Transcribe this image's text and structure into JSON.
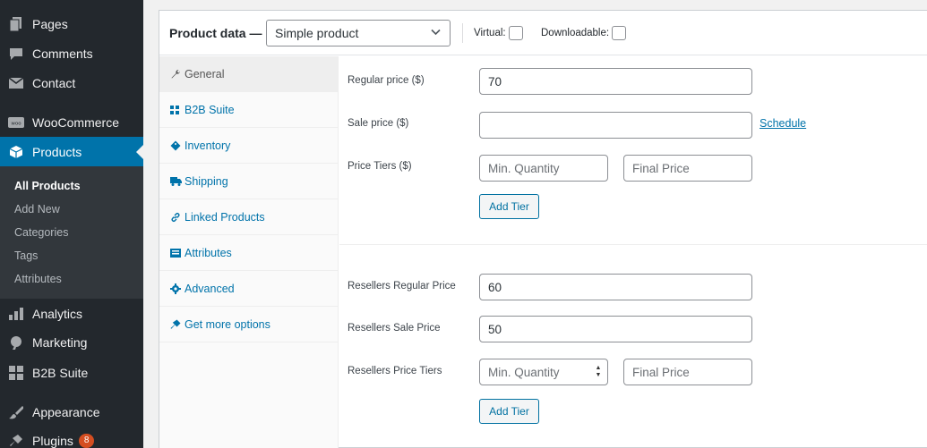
{
  "sidebar": {
    "items": [
      {
        "label": "Pages",
        "icon": "pages-icon"
      },
      {
        "label": "Comments",
        "icon": "comments-icon"
      },
      {
        "label": "Contact",
        "icon": "mail-icon"
      },
      {
        "label": "WooCommerce",
        "icon": "woo-icon"
      },
      {
        "label": "Products",
        "icon": "box-icon"
      },
      {
        "label": "Analytics",
        "icon": "bar-chart-icon"
      },
      {
        "label": "Marketing",
        "icon": "megaphone-icon"
      },
      {
        "label": "B2B Suite",
        "icon": "grid-icon"
      },
      {
        "label": "Appearance",
        "icon": "brush-icon"
      },
      {
        "label": "Plugins",
        "icon": "plug-icon",
        "badge": "8"
      }
    ],
    "submenu": [
      "All Products",
      "Add New",
      "Categories",
      "Tags",
      "Attributes"
    ]
  },
  "product_data": {
    "title": "Product data —",
    "type_select": "Simple product",
    "virtual_label": "Virtual:",
    "downloadable_label": "Downloadable:"
  },
  "tabs": [
    {
      "label": "General",
      "icon": "wrench-icon"
    },
    {
      "label": "B2B Suite",
      "icon": "grid-icon"
    },
    {
      "label": "Inventory",
      "icon": "tag-icon"
    },
    {
      "label": "Shipping",
      "icon": "truck-icon"
    },
    {
      "label": "Linked Products",
      "icon": "link-icon"
    },
    {
      "label": "Attributes",
      "icon": "list-icon"
    },
    {
      "label": "Advanced",
      "icon": "gear-icon"
    },
    {
      "label": "Get more options",
      "icon": "plug-icon"
    }
  ],
  "general": {
    "regular_price_label": "Regular price ($)",
    "regular_price_value": "70",
    "sale_price_label": "Sale price ($)",
    "sale_price_value": "",
    "schedule_link": "Schedule",
    "price_tiers_label": "Price Tiers ($)",
    "min_qty_placeholder": "Min. Quantity",
    "final_price_placeholder": "Final Price",
    "add_tier_label": "Add Tier"
  },
  "resellers": {
    "regular_price_label": "Resellers Regular Price",
    "regular_price_value": "60",
    "sale_price_label": "Resellers Sale Price",
    "sale_price_value": "50",
    "price_tiers_label": "Resellers Price Tiers",
    "min_qty_placeholder": "Min. Quantity",
    "final_price_placeholder": "Final Price",
    "add_tier_label": "Add Tier"
  }
}
